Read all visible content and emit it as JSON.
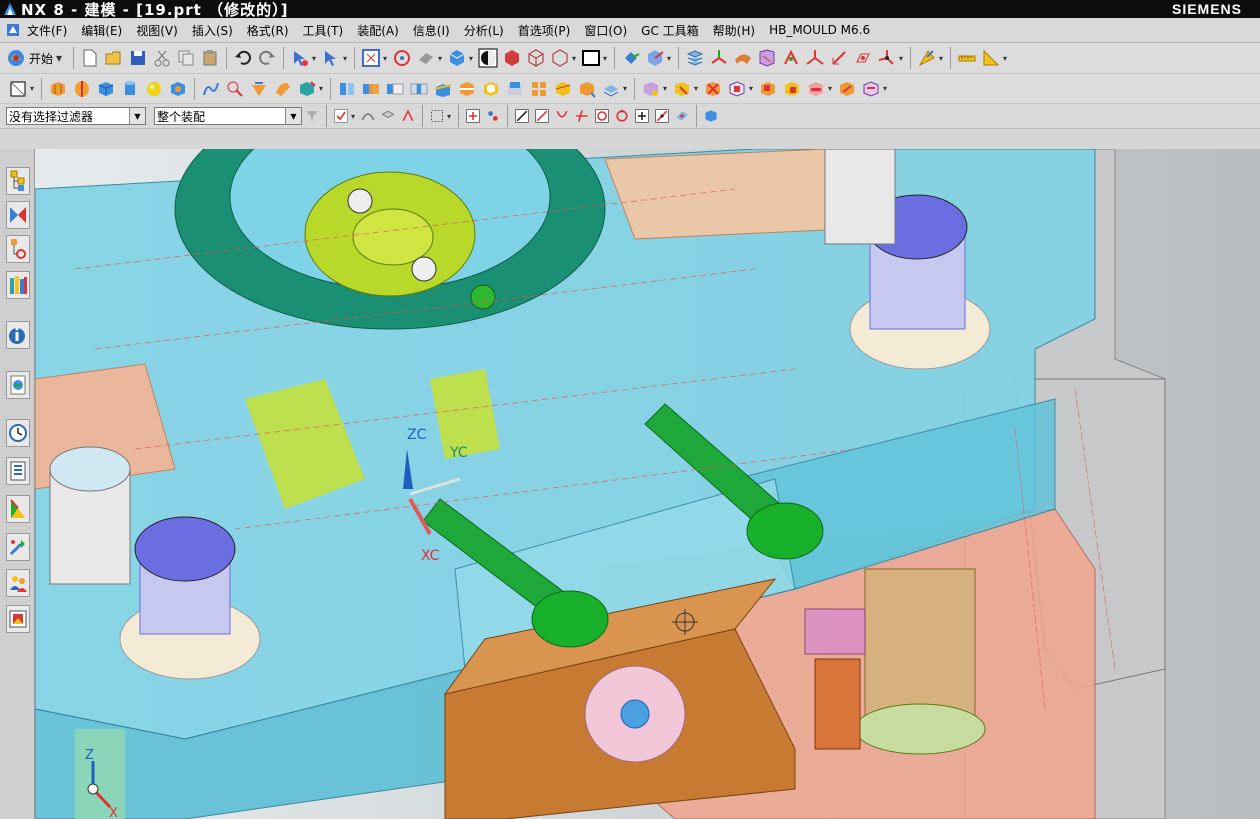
{
  "window": {
    "title": "NX 8 - 建模 - [19.prt （修改的）]",
    "brand": "SIEMENS"
  },
  "menu": {
    "items": [
      "文件(F)",
      "编辑(E)",
      "视图(V)",
      "插入(S)",
      "格式(R)",
      "工具(T)",
      "装配(A)",
      "信息(I)",
      "分析(L)",
      "首选项(P)",
      "窗口(O)",
      "GC 工具箱",
      "帮助(H)",
      "HB_MOULD M6.6"
    ]
  },
  "toolbar": {
    "start_label": "开始"
  },
  "selection": {
    "filter_value": "没有选择过滤器",
    "scope_value": "整个装配"
  },
  "viewport": {
    "axis_labels": {
      "zc": "ZC",
      "yc": "YC",
      "xc": "XC"
    },
    "triad_labels": {
      "z": "Z",
      "x": "X"
    }
  },
  "colors": {
    "accent_blue": "#1f5fbf",
    "plate_cyan": "#7fd3e6",
    "bolt_green": "#18b02a",
    "ring_teal": "#1a8f73",
    "block_orange": "#c77a32",
    "plate_salmon": "#f0a58e",
    "cap_purple": "#6b6ee0"
  }
}
